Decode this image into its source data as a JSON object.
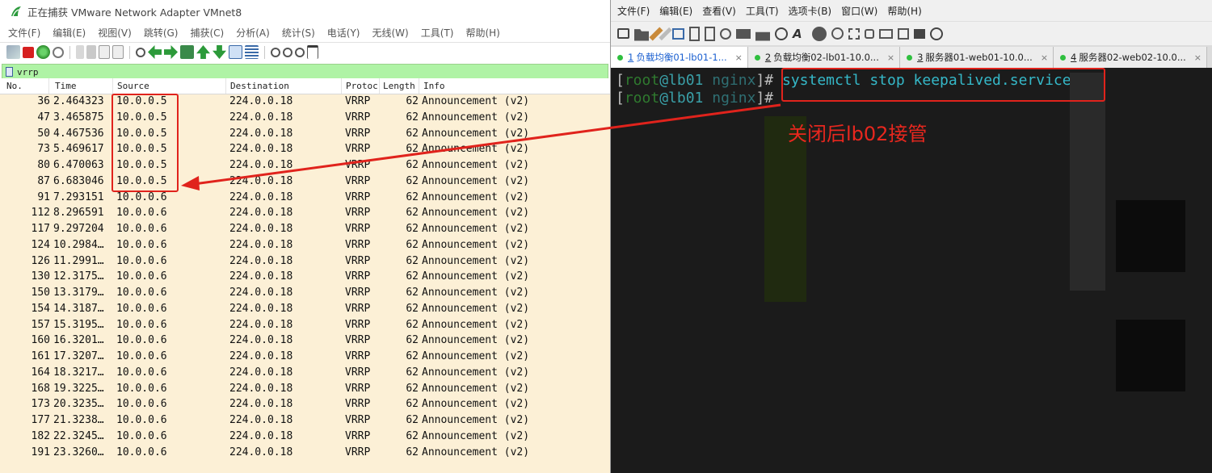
{
  "wireshark": {
    "title": "正在捕获 VMware Network Adapter VMnet8",
    "menu": [
      "文件(F)",
      "编辑(E)",
      "视图(V)",
      "跳转(G)",
      "捕获(C)",
      "分析(A)",
      "统计(S)",
      "电话(Y)",
      "无线(W)",
      "工具(T)",
      "帮助(H)"
    ],
    "filter": "vrrp",
    "columns": [
      "No.",
      "Time",
      "Source",
      "Destination",
      "Protoc",
      "Length",
      "Info"
    ],
    "rows": [
      [
        "36",
        "2.464323",
        "10.0.0.5",
        "224.0.0.18",
        "VRRP",
        "62",
        "Announcement (v2)"
      ],
      [
        "47",
        "3.465875",
        "10.0.0.5",
        "224.0.0.18",
        "VRRP",
        "62",
        "Announcement (v2)"
      ],
      [
        "50",
        "4.467536",
        "10.0.0.5",
        "224.0.0.18",
        "VRRP",
        "62",
        "Announcement (v2)"
      ],
      [
        "73",
        "5.469617",
        "10.0.0.5",
        "224.0.0.18",
        "VRRP",
        "62",
        "Announcement (v2)"
      ],
      [
        "80",
        "6.470063",
        "10.0.0.5",
        "224.0.0.18",
        "VRRP",
        "62",
        "Announcement (v2)"
      ],
      [
        "87",
        "6.683046",
        "10.0.0.5",
        "224.0.0.18",
        "VRRP",
        "62",
        "Announcement (v2)"
      ],
      [
        "91",
        "7.293151",
        "10.0.0.6",
        "224.0.0.18",
        "VRRP",
        "62",
        "Announcement (v2)"
      ],
      [
        "112",
        "8.296591",
        "10.0.0.6",
        "224.0.0.18",
        "VRRP",
        "62",
        "Announcement (v2)"
      ],
      [
        "117",
        "9.297204",
        "10.0.0.6",
        "224.0.0.18",
        "VRRP",
        "62",
        "Announcement (v2)"
      ],
      [
        "124",
        "10.2984…",
        "10.0.0.6",
        "224.0.0.18",
        "VRRP",
        "62",
        "Announcement (v2)"
      ],
      [
        "126",
        "11.2991…",
        "10.0.0.6",
        "224.0.0.18",
        "VRRP",
        "62",
        "Announcement (v2)"
      ],
      [
        "130",
        "12.3175…",
        "10.0.0.6",
        "224.0.0.18",
        "VRRP",
        "62",
        "Announcement (v2)"
      ],
      [
        "150",
        "13.3179…",
        "10.0.0.6",
        "224.0.0.18",
        "VRRP",
        "62",
        "Announcement (v2)"
      ],
      [
        "154",
        "14.3187…",
        "10.0.0.6",
        "224.0.0.18",
        "VRRP",
        "62",
        "Announcement (v2)"
      ],
      [
        "157",
        "15.3195…",
        "10.0.0.6",
        "224.0.0.18",
        "VRRP",
        "62",
        "Announcement (v2)"
      ],
      [
        "160",
        "16.3201…",
        "10.0.0.6",
        "224.0.0.18",
        "VRRP",
        "62",
        "Announcement (v2)"
      ],
      [
        "161",
        "17.3207…",
        "10.0.0.6",
        "224.0.0.18",
        "VRRP",
        "62",
        "Announcement (v2)"
      ],
      [
        "164",
        "18.3217…",
        "10.0.0.6",
        "224.0.0.18",
        "VRRP",
        "62",
        "Announcement (v2)"
      ],
      [
        "168",
        "19.3225…",
        "10.0.0.6",
        "224.0.0.18",
        "VRRP",
        "62",
        "Announcement (v2)"
      ],
      [
        "173",
        "20.3235…",
        "10.0.0.6",
        "224.0.0.18",
        "VRRP",
        "62",
        "Announcement (v2)"
      ],
      [
        "177",
        "21.3238…",
        "10.0.0.6",
        "224.0.0.18",
        "VRRP",
        "62",
        "Announcement (v2)"
      ],
      [
        "182",
        "22.3245…",
        "10.0.0.6",
        "224.0.0.18",
        "VRRP",
        "62",
        "Announcement (v2)"
      ],
      [
        "191",
        "23.3260…",
        "10.0.0.6",
        "224.0.0.18",
        "VRRP",
        "62",
        "Announcement (v2)"
      ]
    ]
  },
  "xshell": {
    "menu": [
      "文件(F)",
      "编辑(E)",
      "查看(V)",
      "工具(T)",
      "选项卡(B)",
      "窗口(W)",
      "帮助(H)"
    ],
    "tabs": [
      {
        "num": "1",
        "label": "负载均衡01-lb01-1...",
        "active": true
      },
      {
        "num": "2",
        "label": "负载均衡02-lb01-10.0...",
        "active": false
      },
      {
        "num": "3",
        "label": "服务器01-web01-10.0...",
        "active": false
      },
      {
        "num": "4",
        "label": "服务器02-web02-10.0...",
        "active": false
      }
    ],
    "terminal": {
      "user": "root",
      "host": "lb01",
      "dir": "nginx",
      "command": "systemctl stop keepalived.service"
    }
  },
  "annotation": {
    "text": "关闭后lb02接管",
    "color": "#e8271e"
  },
  "colors": {
    "packet_bg": "#fcf0d6",
    "filter_bg": "#aff3a5",
    "terminal_bg": "#1b1b1b",
    "annotation_red": "#e0231c"
  }
}
